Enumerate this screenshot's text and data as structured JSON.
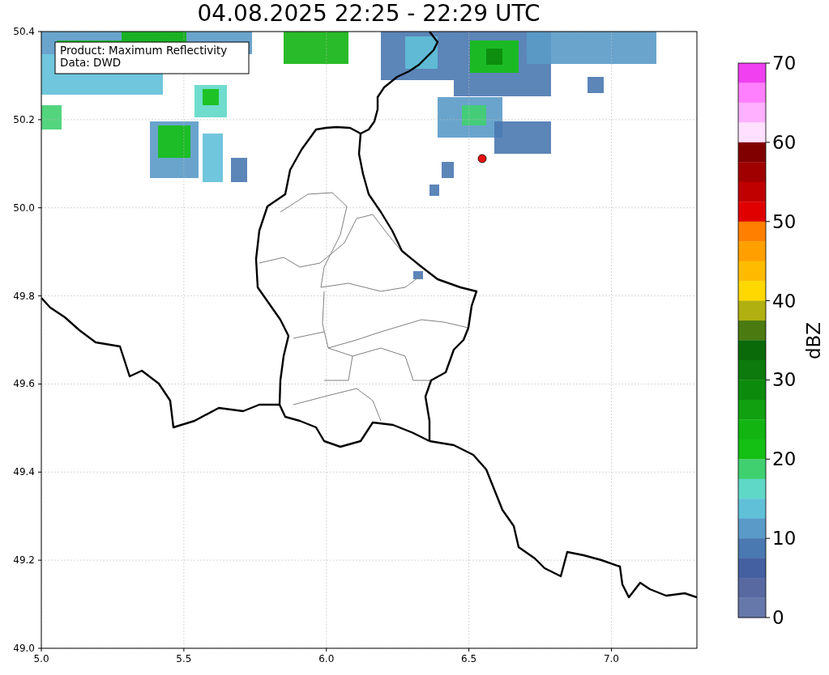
{
  "title": "04.08.2025 22:25 - 22:29 UTC",
  "map": {
    "annotation": [
      "Product: Maximum Reflectivity",
      "Data: DWD"
    ],
    "xticks": [
      "5.0",
      "5.5",
      "6.0",
      "6.5",
      "7.0"
    ],
    "yticks": [
      "50.4",
      "50.2",
      "50.0",
      "49.8",
      "49.6",
      "49.4",
      "49.2",
      "49.0"
    ]
  },
  "colorbar": {
    "label": "dBZ",
    "ticks": [
      "70",
      "60",
      "50",
      "40",
      "30",
      "20",
      "10",
      "0"
    ],
    "bands": [
      {
        "color": "#f040f0"
      },
      {
        "color": "#ff80ff"
      },
      {
        "color": "#ffb0ff"
      },
      {
        "color": "#ffe0ff"
      },
      {
        "color": "#800000"
      },
      {
        "color": "#a00000"
      },
      {
        "color": "#c00000"
      },
      {
        "color": "#e00000"
      },
      {
        "color": "#ff8000"
      },
      {
        "color": "#ffa000"
      },
      {
        "color": "#ffbb00"
      },
      {
        "color": "#ffd800"
      },
      {
        "color": "#b0b010"
      },
      {
        "color": "#4a7a10"
      },
      {
        "color": "#0a6a0a"
      },
      {
        "color": "#0c7a0c"
      },
      {
        "color": "#0c8a0c"
      },
      {
        "color": "#10a010"
      },
      {
        "color": "#12b412"
      },
      {
        "color": "#14c014"
      },
      {
        "color": "#40d070"
      },
      {
        "color": "#60d8c8"
      },
      {
        "color": "#60c0d8"
      },
      {
        "color": "#5a9ac8"
      },
      {
        "color": "#4a78b0"
      },
      {
        "color": "#4460a0"
      },
      {
        "color": "#5869a2"
      },
      {
        "color": "#6677aa"
      }
    ]
  }
}
